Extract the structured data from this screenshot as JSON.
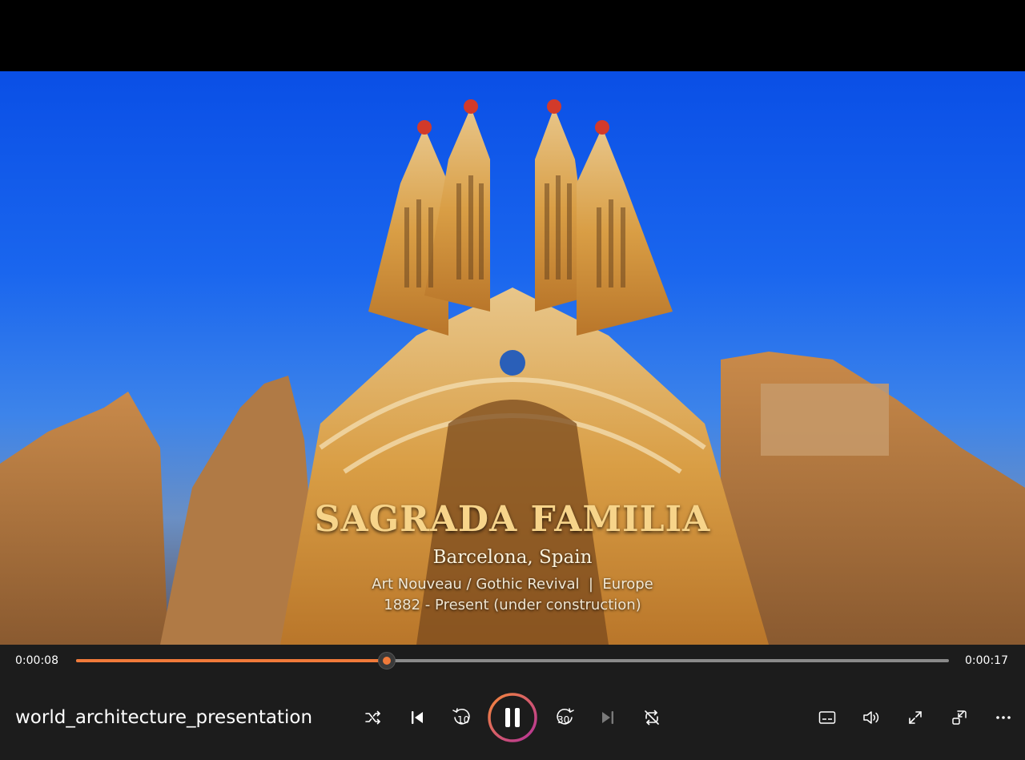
{
  "video": {
    "title": "SAGRADA FAMILIA",
    "location": "Barcelona, Spain",
    "style_line": "Art Nouveau / Gothic Revival  |  Europe",
    "years": "1882 - Present (under construction)"
  },
  "player": {
    "elapsed": "0:00:08",
    "duration": "0:00:17",
    "progress_fraction": 0.356,
    "file_title": "world_architecture_presentation",
    "skip_back_seconds": "10",
    "skip_forward_seconds": "30",
    "accent_color": "#f07a3a",
    "controls": [
      "shuffle-icon",
      "previous-icon",
      "skip-back-10-icon",
      "pause-icon",
      "skip-forward-30-icon",
      "next-icon",
      "repeat-off-icon",
      "subtitles-icon",
      "volume-icon",
      "fullscreen-icon",
      "mini-player-icon",
      "more-options-icon"
    ]
  }
}
